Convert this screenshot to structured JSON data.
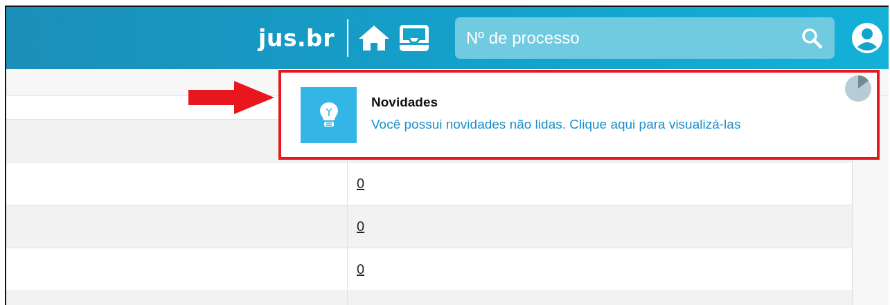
{
  "header": {
    "logo": "jus.br",
    "search": {
      "placeholder": "Nº de processo"
    }
  },
  "table": {
    "rows": [
      {},
      {},
      {
        "column_2": "0"
      },
      {
        "column_2": "0"
      },
      {
        "column_2": "0"
      },
      {}
    ]
  },
  "toast": {
    "title": "Novidades",
    "message": "Você possui novidades não lidas. Clique aqui para visualizá-las"
  }
}
